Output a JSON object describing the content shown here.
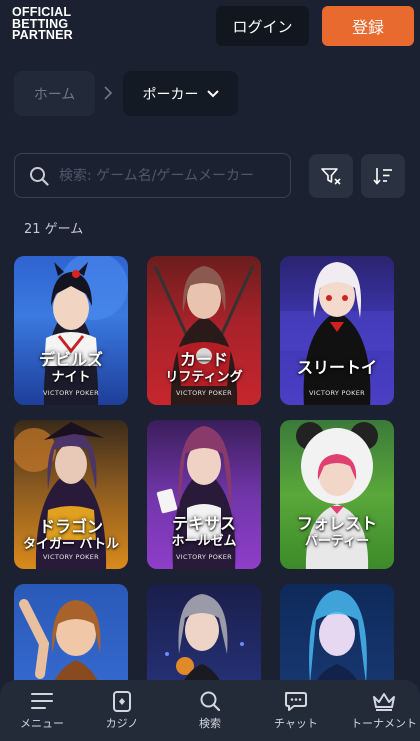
{
  "header": {
    "logo_lines": [
      "OFFICIAL",
      "BETTING",
      "PARTNER"
    ],
    "login_label": "ログイン",
    "register_label": "登録",
    "colors": {
      "register_bg": "#e96a2e",
      "login_bg": "#12171f"
    }
  },
  "breadcrumb": {
    "home": "ホーム",
    "current": "ポーカー"
  },
  "search": {
    "placeholder": "検索: ゲーム名/ゲームメーカー"
  },
  "game_count": "21 ゲーム",
  "games": [
    {
      "line1": "デビルズ",
      "line2": "ナイト",
      "provider": "VICTORY POKER",
      "color": "#3a6fd8"
    },
    {
      "line1": "カード",
      "line2": "リフティング",
      "provider": "VICTORY POKER",
      "color": "#c6262e"
    },
    {
      "line1": "スリートイ",
      "line2": "",
      "provider": "VICTORY POKER",
      "color": "#4b3fc4"
    },
    {
      "line1": "ドラゴン",
      "line2": "タイガー バトル",
      "provider": "VICTORY POKER",
      "color": "#d98a1c"
    },
    {
      "line1": "テキサス",
      "line2": "ホールゼム",
      "provider": "VICTORY POKER",
      "color": "#8e3ec9"
    },
    {
      "line1": "フォレスト",
      "line2": "パーティー",
      "provider": "VICTORY POKER",
      "color": "#5aa83a"
    },
    {
      "line1": "",
      "line2": "",
      "provider": "",
      "color": "#3a6fd8"
    },
    {
      "line1": "",
      "line2": "",
      "provider": "",
      "color": "#2a3a8a"
    },
    {
      "line1": "",
      "line2": "",
      "provider": "",
      "color": "#1c3d7a"
    }
  ],
  "bottom_nav": [
    {
      "label": "メニュー",
      "icon": "menu-icon"
    },
    {
      "label": "カジノ",
      "icon": "casino-icon"
    },
    {
      "label": "検索",
      "icon": "search-icon"
    },
    {
      "label": "チャット",
      "icon": "chat-icon"
    },
    {
      "label": "トーナメント",
      "icon": "crown-icon"
    }
  ]
}
